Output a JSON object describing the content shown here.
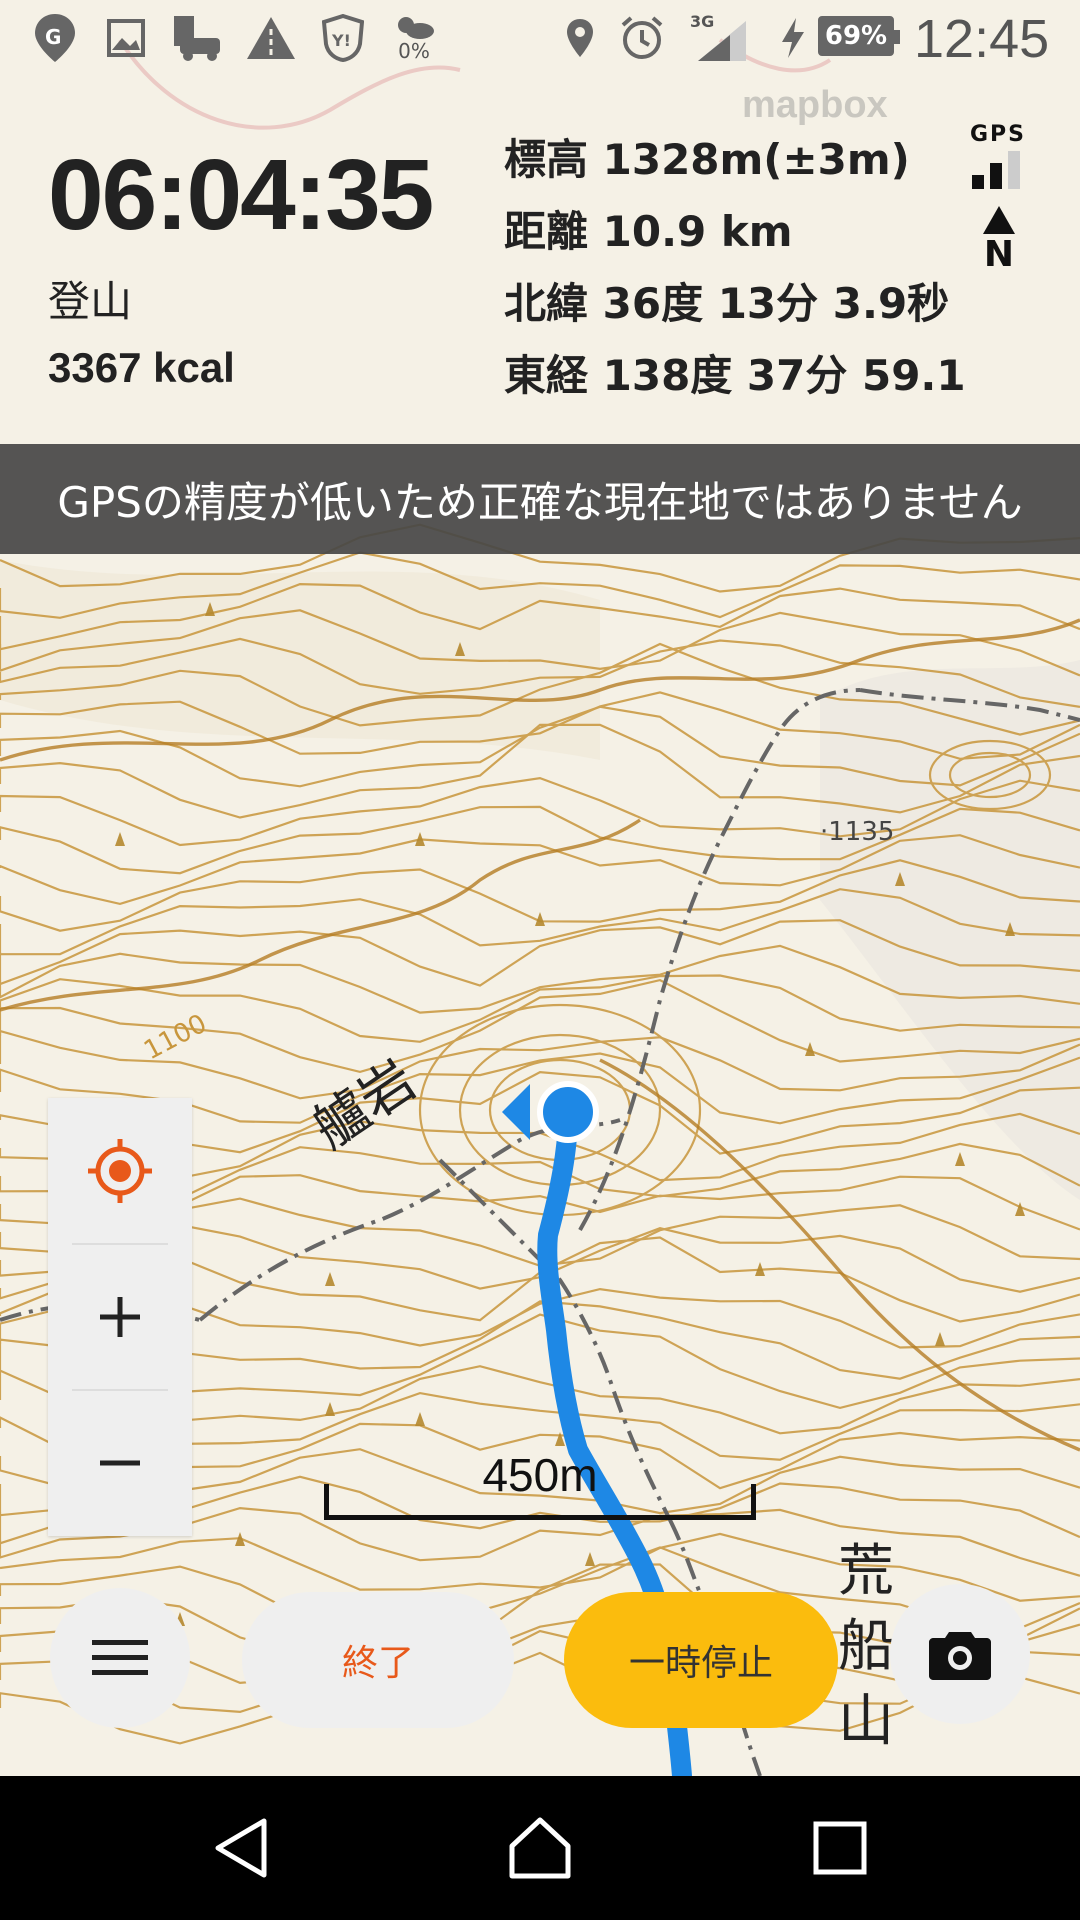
{
  "status_bar": {
    "icons": [
      "maps-notification-icon",
      "image-notification-icon",
      "parking-notification-icon",
      "road-notification-icon",
      "yahoo-shield-icon",
      "weather-icon",
      "location-icon",
      "alarm-icon",
      "signal-icon",
      "charging-icon"
    ],
    "weather_percent": "0%",
    "network_type": "3G",
    "battery_level": "69%",
    "time": "12:45"
  },
  "map_attribution": "mapbox",
  "stats": {
    "elapsed_time": "06:04:35",
    "activity": "登山",
    "calories": "3367 kcal",
    "altitude": "標高 1328m(±3m)",
    "distance": "距離 10.9 km",
    "latitude": "北緯 36度 13分 3.9秒",
    "longitude": "東経 138度 37分 59.1"
  },
  "gps_indicator": {
    "label": "GPS",
    "signal_bars_active": 2,
    "signal_bars_total": 3
  },
  "compass": {
    "label": "N"
  },
  "gps_warning": "GPSの精度が低いため正確な現在地ではありません",
  "map_labels": {
    "spot_height": "·1135",
    "rock": "艫岩",
    "contour": "1100",
    "mountain": [
      "荒",
      "船",
      "山"
    ]
  },
  "scale": {
    "label": "450m"
  },
  "controls": {
    "locate_icon": "target-icon",
    "zoom_in_icon": "plus-icon",
    "zoom_out_icon": "minus-icon"
  },
  "bottom_bar": {
    "menu_icon": "hamburger-menu-icon",
    "end_label": "終了",
    "pause_label": "一時停止",
    "camera_icon": "camera-icon"
  },
  "colors": {
    "accent_orange": "#e8591a",
    "pause_yellow": "#fbbc0d",
    "track_blue": "#1e88e5",
    "contour": "#c8963c",
    "banner_bg": "#464646"
  },
  "nav_bar": {
    "icons": [
      "back-triangle-icon",
      "home-icon",
      "recents-icon"
    ]
  }
}
